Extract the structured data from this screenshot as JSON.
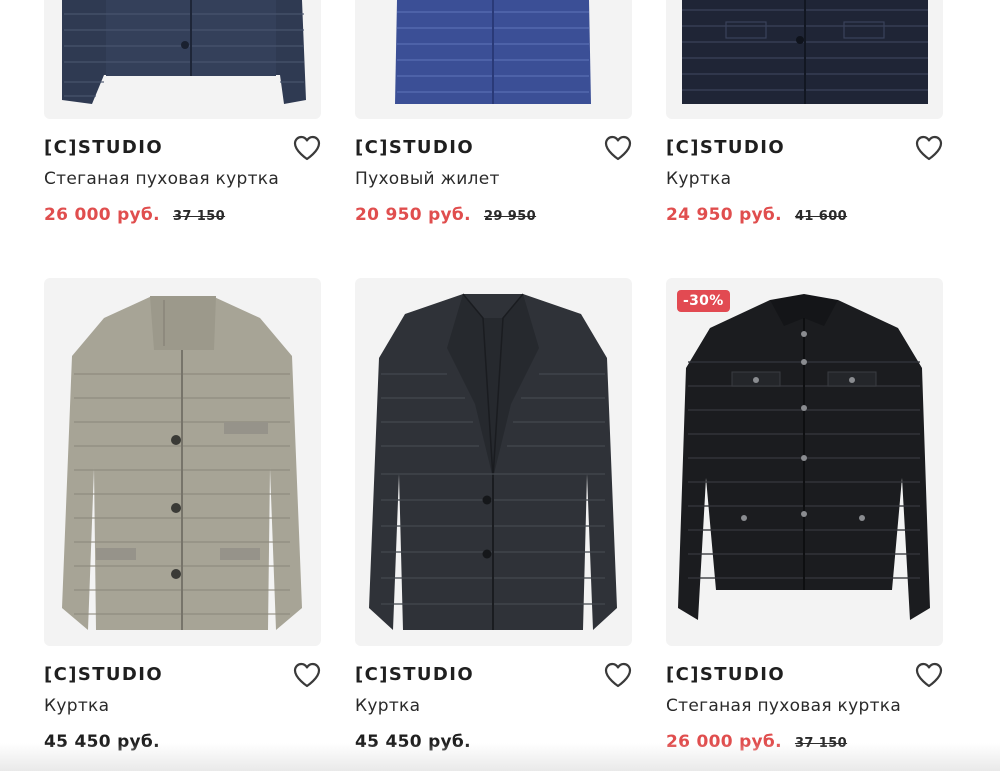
{
  "colors": {
    "sale_price": "#e04e4e",
    "regular_price": "#1f1f1f",
    "badge_bg": "#e24a52",
    "image_bg": "#f3f3f3"
  },
  "products": [
    {
      "brand": "[C]STUDIO",
      "name": "Стеганая пуховая куртка",
      "price": "26 000 руб.",
      "old_price": "37 150",
      "icon": "heart-icon"
    },
    {
      "brand": "[C]STUDIO",
      "name": "Пуховый жилет",
      "price": "20 950 руб.",
      "old_price": "29 950",
      "icon": "heart-icon"
    },
    {
      "brand": "[C]STUDIO",
      "name": "Куртка",
      "price": "24 950 руб.",
      "old_price": "41 600",
      "icon": "heart-icon"
    },
    {
      "brand": "[C]STUDIO",
      "name": "Куртка",
      "price": "45 450 руб.",
      "icon": "heart-icon"
    },
    {
      "brand": "[C]STUDIO",
      "name": "Куртка",
      "price": "45 450 руб.",
      "icon": "heart-icon"
    },
    {
      "brand": "[C]STUDIO",
      "name": "Стеганая пуховая куртка",
      "price": "26 000 руб.",
      "old_price": "37 150",
      "badge": "-30%",
      "icon": "heart-icon"
    }
  ]
}
